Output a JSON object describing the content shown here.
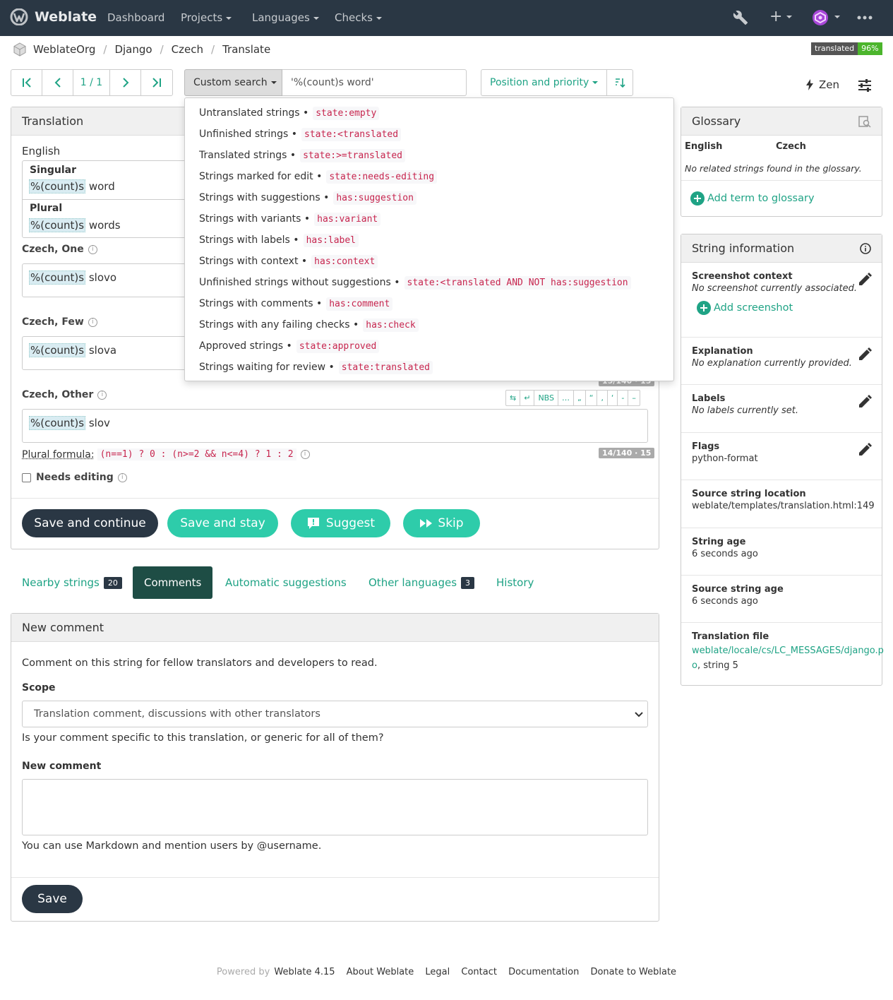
{
  "nav": {
    "brand": "Weblate",
    "items": [
      "Dashboard",
      "Projects",
      "Languages",
      "Checks"
    ]
  },
  "breadcrumb": [
    "WeblateOrg",
    "Django",
    "Czech",
    "Translate"
  ],
  "badge": {
    "label": "translated",
    "value": "96%"
  },
  "toolbar": {
    "pager_count": "1 / 1",
    "search_button": "Custom search",
    "search_value": "'%(count)s word'",
    "sort_button": "Position and priority",
    "zen": "Zen"
  },
  "translation": {
    "heading": "Translation",
    "source_lang": "English",
    "singular_label": "Singular",
    "singular_ph": "%(count)s",
    "singular_rest": " word",
    "plural_label": "Plural",
    "plural_ph": "%(count)s",
    "plural_rest": " words",
    "one_label": "Czech, One",
    "one_ph": "%(count)s",
    "one_rest": " slovo",
    "few_label": "Czech, Few",
    "few_ph": "%(count)s",
    "few_rest": " slova",
    "few_counter": "15/140 · 15",
    "other_label": "Czech, Other",
    "other_ph": "%(count)s",
    "other_rest": " slov",
    "other_counter": "14/140 · 15",
    "keys": [
      "⇆",
      "↵",
      "NBS",
      "…",
      "„",
      "“",
      "‚",
      "‘",
      "-",
      "–"
    ],
    "plural_formula_label": "Plural formula:",
    "plural_formula": "(n==1) ? 0 : (n>=2 && n<=4) ? 1 : 2",
    "needs_editing": "Needs editing",
    "buttons": {
      "save_continue": "Save and continue",
      "save_stay": "Save and stay",
      "suggest": "Suggest",
      "skip": "Skip"
    }
  },
  "tabs": [
    {
      "label": "Nearby strings",
      "count": "20"
    },
    {
      "label": "Comments"
    },
    {
      "label": "Automatic suggestions"
    },
    {
      "label": "Other languages",
      "count": "3"
    },
    {
      "label": "History"
    }
  ],
  "comment": {
    "heading": "New comment",
    "intro": "Comment on this string for fellow translators and developers to read.",
    "scope_label": "Scope",
    "scope_value": "Translation comment, discussions with other translators",
    "scope_help": "Is your comment specific to this translation, or generic for all of them?",
    "new_comment_label": "New comment",
    "markdown_help": "You can use Markdown and mention users by @username.",
    "save": "Save"
  },
  "dropdown": [
    {
      "label": "Untranslated strings",
      "code": "state:empty"
    },
    {
      "label": "Unfinished strings",
      "code": "state:<translated"
    },
    {
      "label": "Translated strings",
      "code": "state:>=translated"
    },
    {
      "label": "Strings marked for edit",
      "code": "state:needs-editing"
    },
    {
      "label": "Strings with suggestions",
      "code": "has:suggestion"
    },
    {
      "label": "Strings with variants",
      "code": "has:variant"
    },
    {
      "label": "Strings with labels",
      "code": "has:label"
    },
    {
      "label": "Strings with context",
      "code": "has:context"
    },
    {
      "label": "Unfinished strings without suggestions",
      "code": "state:<translated AND NOT has:suggestion"
    },
    {
      "label": "Strings with comments",
      "code": "has:comment"
    },
    {
      "label": "Strings with any failing checks",
      "code": "has:check"
    },
    {
      "label": "Approved strings",
      "code": "state:approved"
    },
    {
      "label": "Strings waiting for review",
      "code": "state:translated"
    }
  ],
  "glossary": {
    "heading": "Glossary",
    "col_source": "English",
    "col_target": "Czech",
    "empty": "No related strings found in the glossary.",
    "add": "Add term to glossary"
  },
  "string_info": {
    "heading": "String information",
    "screenshot_title": "Screenshot context",
    "screenshot_value": "No screenshot currently associated.",
    "add_screenshot": "Add screenshot",
    "explanation_title": "Explanation",
    "explanation_value": "No explanation currently provided.",
    "labels_title": "Labels",
    "labels_value": "No labels currently set.",
    "flags_title": "Flags",
    "flags_value": "python-format",
    "location_title": "Source string location",
    "location_value": "weblate/templates/translation.html:149",
    "age_title": "String age",
    "age_value": "6 seconds ago",
    "source_age_title": "Source string age",
    "source_age_value": "6 seconds ago",
    "file_title": "Translation file",
    "file_line1": "weblate/locale/cs/LC_MESSAGES/django.p",
    "file_line2": "o",
    "file_suffix": ", string 5"
  },
  "footer": {
    "powered_by": "Powered by",
    "version": "Weblate 4.15",
    "links": [
      "About Weblate",
      "Legal",
      "Contact",
      "Documentation",
      "Donate to Weblate"
    ]
  },
  "colors": {
    "navbar": "#2a3744",
    "accent": "#1fa385",
    "button_teal": "#2eccaa",
    "badge_green": "#4bb52c"
  }
}
